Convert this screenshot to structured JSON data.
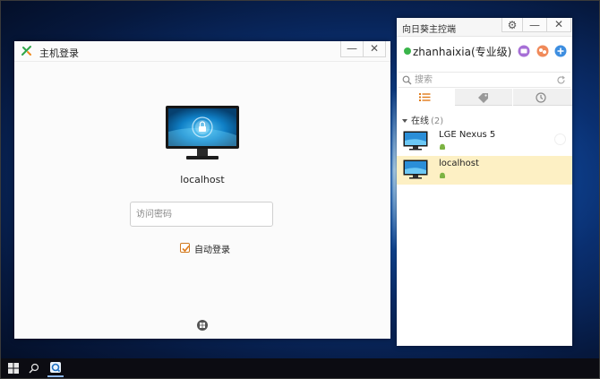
{
  "login_window": {
    "title": "主机登录",
    "hostname": "localhost",
    "password_placeholder": "访问密码",
    "password_value": "",
    "autologin_label": "自动登录",
    "autologin_checked": true,
    "minimize_glyph": "—",
    "close_glyph": "✕"
  },
  "control_panel": {
    "title": "向日葵主控端",
    "gear_glyph": "⚙",
    "minimize_glyph": "—",
    "close_glyph": "✕",
    "username": "zhanhaixia(专业级)",
    "search_placeholder": "搜索",
    "tabs": [
      {
        "icon": "list-icon"
      },
      {
        "icon": "tag-icon"
      },
      {
        "icon": "clock-icon"
      }
    ],
    "group": {
      "label": "在线",
      "count": "(2)"
    },
    "devices": [
      {
        "name": "LGE Nexus 5",
        "selected": false
      },
      {
        "name": "localhost",
        "selected": true
      }
    ]
  },
  "colors": {
    "accent_orange": "#e07b1a",
    "online_green": "#3ab54a",
    "selected_row": "#fdf0c4"
  }
}
